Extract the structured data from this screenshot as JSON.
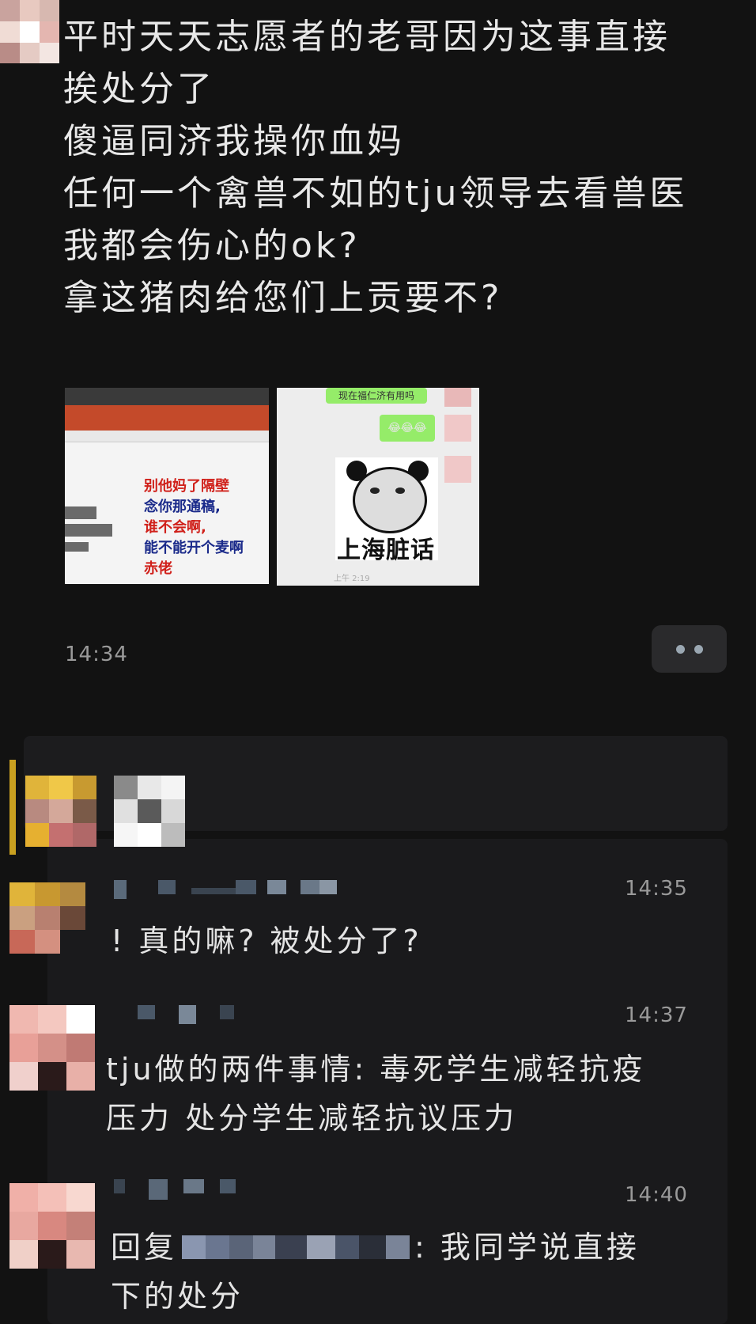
{
  "top_message": {
    "lines": [
      "平时天天志愿者的老哥因为这事直接",
      "挨处分了",
      "傻逼同济我操你血妈",
      "任何一个禽兽不如的tju领导去看兽医",
      "我都会伤心的ok?",
      "拿这猪肉给您们上贡要不?"
    ],
    "time": "14:34"
  },
  "image_1": {
    "lines": [
      "别他妈了隔壁",
      "念你那通稿,",
      "谁不会啊,",
      "能不能开个麦啊",
      "赤佬"
    ]
  },
  "image_2": {
    "top_bubble": "现在福仁济有用吗",
    "emoji_bubble": "😂😂😂",
    "sticker_caption": "上海脏话",
    "time_faint": "上午 2:19"
  },
  "messages": [
    {
      "time": "14:35",
      "lines": [
        "! 真的嘛? 被处分了?"
      ]
    },
    {
      "time": "14:37",
      "lines": [
        "tju做的两件事情: 毒死学生减轻抗疫",
        "压力 处分学生减轻抗议压力"
      ]
    },
    {
      "time": "14:40",
      "reply_prefix": "回复",
      "lines_after": ": 我同学说直接",
      "lines": [
        "下的处分"
      ]
    }
  ],
  "colors": {
    "background": "#121212",
    "panel": "#1c1c1e",
    "text": "#e6e6e6",
    "time": "#9a9a9a",
    "red_text": "#d0201a",
    "blue_text": "#1a2a8a",
    "wechat_green": "#95ec69"
  }
}
